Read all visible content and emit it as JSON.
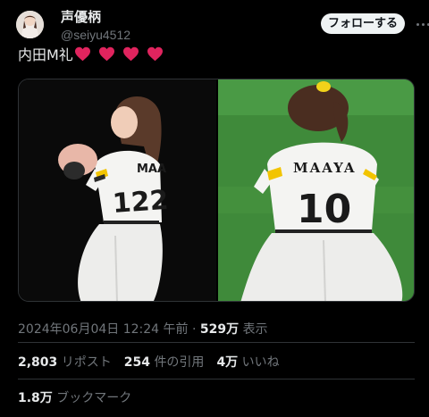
{
  "author": {
    "display_name": "声優柄",
    "handle": "@seiyu4512",
    "avatar_icon": "avatar-icon"
  },
  "follow_label": "フォローする",
  "more_icon": "more-options-icon",
  "tweet": {
    "text": "内田M礼",
    "hearts": [
      "heart-icon",
      "heart-icon",
      "heart-icon",
      "heart-icon"
    ],
    "heart_color": "#e0245e"
  },
  "media": {
    "left_jersey": {
      "name": "MAA",
      "number": "122"
    },
    "right_jersey": {
      "name": "MAAYA",
      "number": "10"
    }
  },
  "meta": {
    "timestamp": "2024年06月04日 12:24 午前",
    "separator": " · ",
    "views_count": "529万",
    "views_label": "表示"
  },
  "stats": {
    "reposts": {
      "count": "2,803",
      "label": "リポスト"
    },
    "quotes": {
      "count": "254",
      "label": "件の引用"
    },
    "likes": {
      "count": "4万",
      "label": "いいね"
    },
    "bookmarks": {
      "count": "1.8万",
      "label": "ブックマーク"
    }
  },
  "colors": {
    "background": "#000000",
    "text_primary": "#e7e9ea",
    "text_secondary": "#71767b",
    "follow_bg": "#eff3f4",
    "divider": "#2f3336"
  }
}
